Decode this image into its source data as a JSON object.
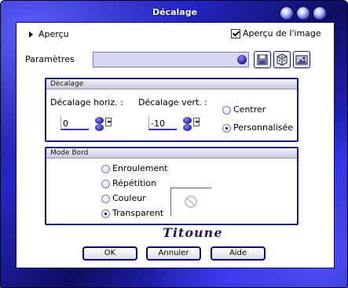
{
  "window": {
    "title": "Décalage"
  },
  "preview": {
    "toggle_label": "Aperçu",
    "image_preview_label": "Aperçu de l'image",
    "image_preview_checked": true
  },
  "params": {
    "label": "Paramètres",
    "preset_value": ""
  },
  "offset_group": {
    "title": "Décalage",
    "horiz_label": "Décalage horiz. :",
    "horiz_value": "0",
    "vert_label": "Décalage vert. :",
    "vert_value": "-10",
    "options": [
      {
        "label": "Centrer",
        "selected": false
      },
      {
        "label": "Personnalisée",
        "selected": true
      }
    ]
  },
  "edge_group": {
    "title": "Mode Bord",
    "options": [
      {
        "label": "Enroulement",
        "selected": false
      },
      {
        "label": "Répétition",
        "selected": false
      },
      {
        "label": "Couleur",
        "selected": false
      },
      {
        "label": "Transparent",
        "selected": true
      }
    ]
  },
  "signature": "Titoune",
  "buttons": {
    "ok": "OK",
    "cancel": "Annuler",
    "help": "Aide"
  }
}
